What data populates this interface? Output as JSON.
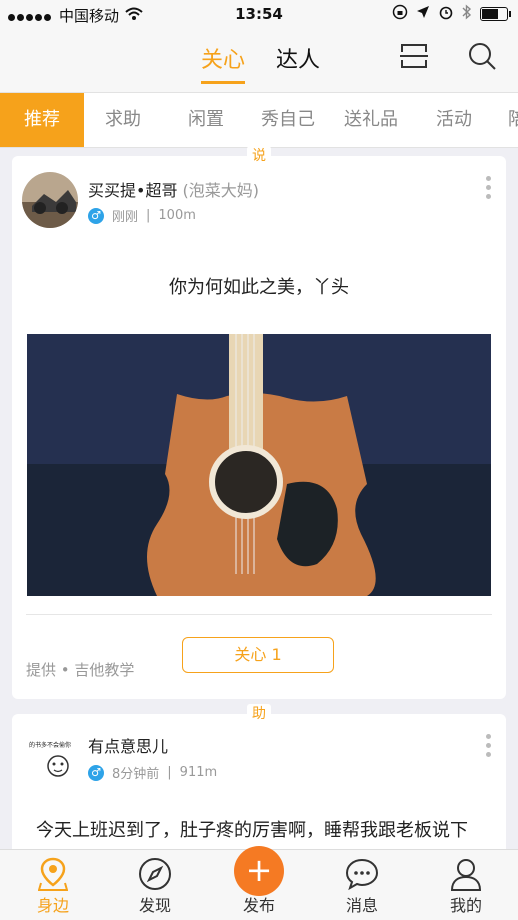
{
  "status_bar": {
    "carrier": "中国移动",
    "time": "13:54"
  },
  "header": {
    "tab_active": "关心",
    "tab_inactive": "达人"
  },
  "categories": [
    "推荐",
    "求助",
    "闲置",
    "秀自己",
    "送礼品",
    "活动",
    "陪"
  ],
  "feed": {
    "post1": {
      "type_badge": "说",
      "username": "买买提•超哥",
      "nickname": "(泡菜大妈)",
      "time": "刚刚",
      "distance": "100m",
      "text": "你为何如此之美，丫头",
      "provider": "提供 • 吉他教学",
      "care_label": "关心 1"
    },
    "post2": {
      "type_badge": "助",
      "username": "有点意思儿",
      "avatar_text": "的书多不会偷你",
      "time": "8分钟前",
      "distance": "911m",
      "text": "今天上班迟到了，肚子疼的厉害啊，睡帮我跟老板说下sorry"
    }
  },
  "tabbar": {
    "items": [
      "身边",
      "发现",
      "发布",
      "消息",
      "我的"
    ]
  },
  "colors": {
    "accent": "#f6a21b",
    "publish": "#f57a23",
    "gender": "#2ea3e8"
  }
}
